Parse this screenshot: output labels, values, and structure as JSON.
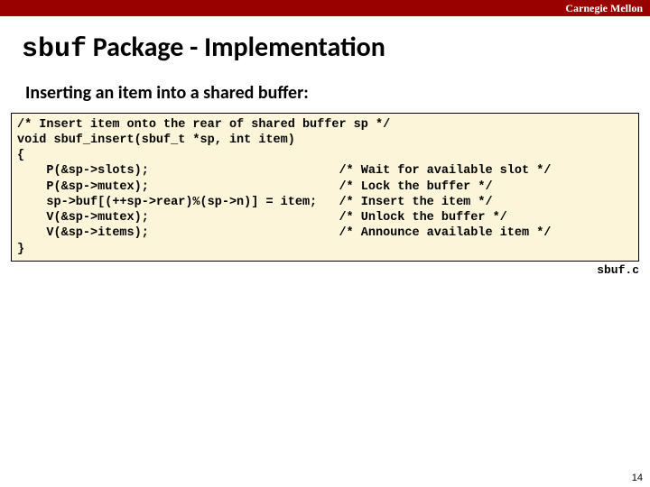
{
  "brand": "Carnegie Mellon",
  "title_mono": "sbuf",
  "title_rest": " Package - Implementation",
  "subtitle": "Inserting an item into a shared buffer:",
  "code": "/* Insert item onto the rear of shared buffer sp */\nvoid sbuf_insert(sbuf_t *sp, int item)\n{\n    P(&sp->slots);                          /* Wait for available slot */\n    P(&sp->mutex);                          /* Lock the buffer */\n    sp->buf[(++sp->rear)%(sp->n)] = item;   /* Insert the item */\n    V(&sp->mutex);                          /* Unlock the buffer */\n    V(&sp->items);                          /* Announce available item */\n}",
  "source_file": "sbuf.c",
  "page_number": "14"
}
